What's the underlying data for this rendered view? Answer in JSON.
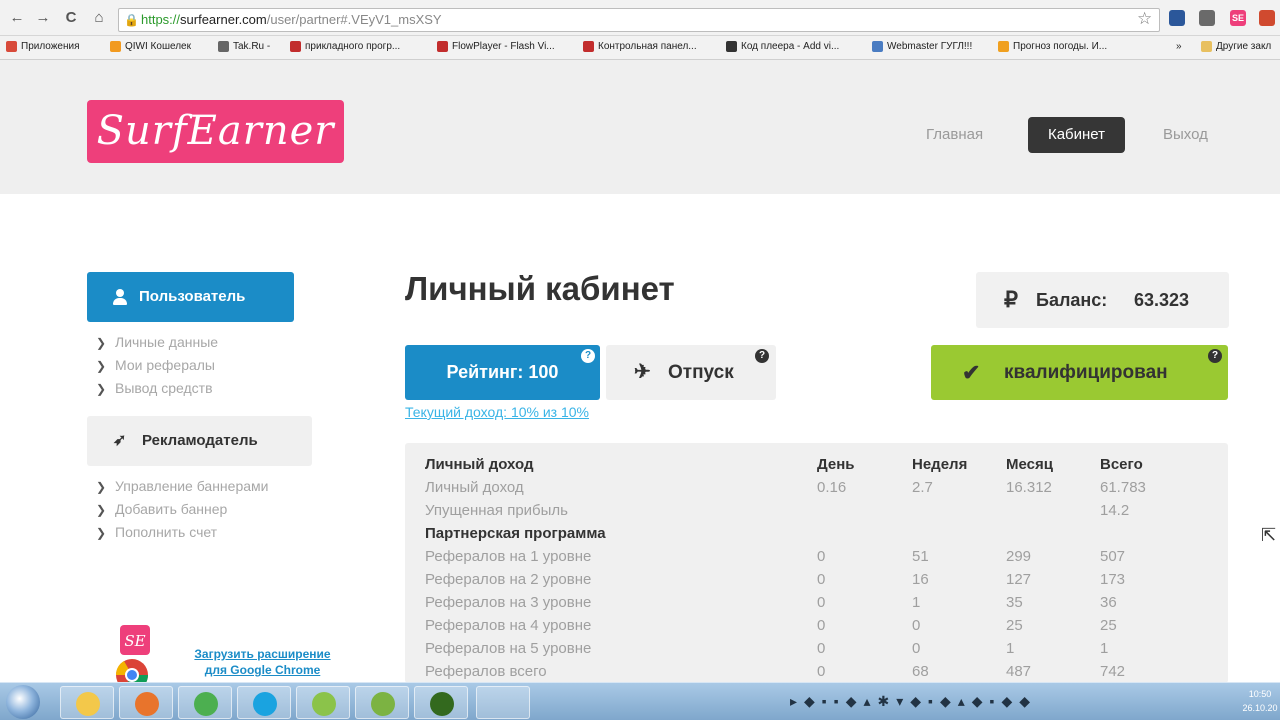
{
  "browser": {
    "url_scheme": "https://",
    "url_host": "surfearner.com",
    "url_path": "/user/partner#.VEyV1_msXSY",
    "nav": {
      "back": "←",
      "forward": "→",
      "reload": "C",
      "home": "⌂"
    },
    "lock_glyph": "🔒",
    "star_glyph": "☆",
    "extensions": [
      {
        "label": "",
        "color": "#2b579a"
      },
      {
        "label": "",
        "color": "#6a6a6a"
      },
      {
        "label": "SE",
        "color": "#ee3f7b"
      },
      {
        "label": "",
        "color": "#d04a2f"
      }
    ],
    "bookmarks": [
      {
        "label": "Приложения",
        "color": "#d84a3a"
      },
      {
        "label": "QIWI Кошелек",
        "color": "#f29a1f"
      },
      {
        "label": "Tak.Ru -",
        "color": "#666666"
      },
      {
        "label": "прикладного прогр...",
        "color": "#c22d2d"
      },
      {
        "label": "FlowPlayer - Flash Vi...",
        "color": "#c22d2d"
      },
      {
        "label": "Контрольная панел...",
        "color": "#c22d2d"
      },
      {
        "label": "Код плеера - Add vi...",
        "color": "#333333"
      },
      {
        "label": "Webmaster ГУГЛ!!!",
        "color": "#4a7cc2"
      },
      {
        "label": "Прогноз погоды. И...",
        "color": "#f0a020"
      }
    ],
    "bookmarks_more": "»",
    "other_bookmarks": "Другие закл"
  },
  "site": {
    "logo": "SurfEarner",
    "nav": {
      "home": "Главная",
      "cabinet": "Кабинет",
      "logout": "Выход"
    }
  },
  "sidebar": {
    "user_button": "Пользователь",
    "user_links": [
      "Личные данные",
      "Мои рефералы",
      "Вывод средств"
    ],
    "advertiser_button": "Рекламодатель",
    "advertiser_links": [
      "Управление баннерами",
      "Добавить баннер",
      "Пополнить счет"
    ],
    "chrome_link_line1": "Загрузить расширение",
    "chrome_link_line2": "для Google Chrome"
  },
  "main": {
    "title": "Личный кабинет",
    "balance_label": "Баланс:",
    "balance_value": "63.323",
    "rating_button": "Рейтинг: 100",
    "vacation_button": "Отпуск",
    "qualified_button": "квалифицирован",
    "current_income_link": "Текущий доход: 10% из 10%",
    "help_glyph": "?"
  },
  "table": {
    "header": [
      "Личный доход",
      "День",
      "Неделя",
      "Месяц",
      "Всего"
    ],
    "rows": [
      [
        "Личный доход",
        "0.16",
        "2.7",
        "16.312",
        "61.783"
      ],
      [
        "Упущенная прибыль",
        "",
        "",
        "",
        "14.2"
      ]
    ],
    "section": "Партнерская программа",
    "partner_rows": [
      [
        "Рефералов на 1 уровне",
        "0",
        "51",
        "299",
        "507"
      ],
      [
        "Рефералов на 2 уровне",
        "0",
        "16",
        "127",
        "173"
      ],
      [
        "Рефералов на 3 уровне",
        "0",
        "1",
        "35",
        "36"
      ],
      [
        "Рефералов на 4 уровне",
        "0",
        "0",
        "25",
        "25"
      ],
      [
        "Рефералов на 5 уровне",
        "0",
        "0",
        "1",
        "1"
      ],
      [
        "Рефералов всего",
        "0",
        "68",
        "487",
        "742"
      ]
    ]
  },
  "taskbar": {
    "apps": [
      {
        "color": "#f3c84a"
      },
      {
        "color": "#e8742c"
      },
      {
        "color": "#4caf50"
      },
      {
        "color": "#1aa3e0"
      },
      {
        "color": "#8bc34a"
      },
      {
        "color": "#7cb342"
      },
      {
        "color": "#33691e"
      }
    ],
    "tray_glyphs": "▸◆▪▪◆▴✱▾◆▪◆▴◆▪◆◆",
    "time": "10:50",
    "date": "26.10.20"
  }
}
